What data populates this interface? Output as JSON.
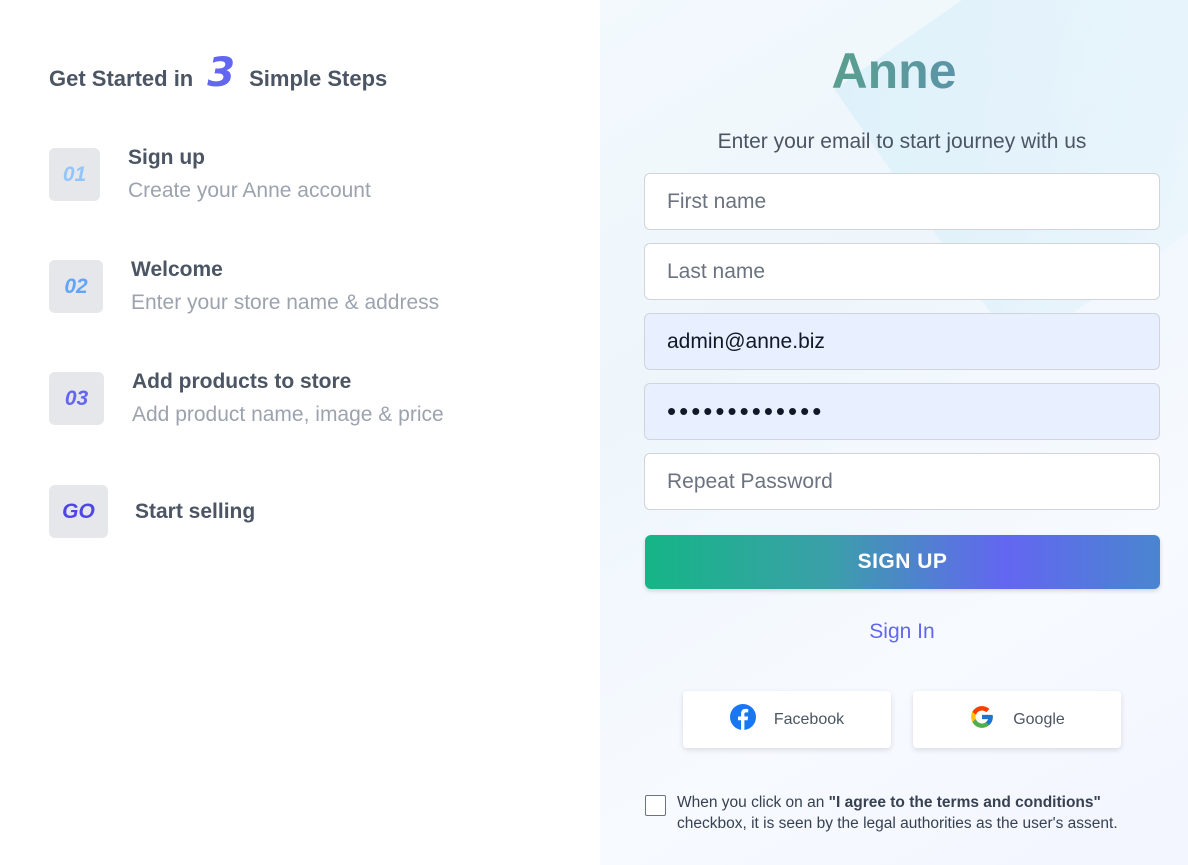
{
  "left": {
    "headline_prefix": "Get Started in",
    "headline_number": "3",
    "headline_suffix": "Simple Steps",
    "steps": [
      {
        "badge": "01",
        "title": "Sign up",
        "subtitle": "Create your Anne account"
      },
      {
        "badge": "02",
        "title": "Welcome",
        "subtitle": "Enter your store name & address"
      },
      {
        "badge": "03",
        "title": "Add products to store",
        "subtitle": "Add product name, image & price"
      },
      {
        "badge": "GO",
        "title": "Start selling"
      }
    ]
  },
  "form": {
    "brand": "Anne",
    "tagline": "Enter your email to start journey with us",
    "first_name": {
      "placeholder": "First name",
      "value": ""
    },
    "last_name": {
      "placeholder": "Last name",
      "value": ""
    },
    "email": {
      "value": "admin@anne.biz"
    },
    "password": {
      "display": "•••••••••••••"
    },
    "repeat_password": {
      "placeholder": "Repeat Password",
      "value": ""
    },
    "signup_button": "SIGN UP",
    "signin_link": "Sign In",
    "social": {
      "facebook": "Facebook",
      "google": "Google"
    },
    "consent": {
      "before": "When you click on an ",
      "bold": "\"I agree to the terms and conditions\"",
      "after": " checkbox, it is seen by the legal authorities as the user's assent.",
      "checked": false
    }
  },
  "colors": {
    "accent": "#6366f1",
    "brand_gradient_start": "#3faa6e",
    "brand_gradient_end": "#5f7fd8",
    "button_gradient_start": "#15b586",
    "button_gradient_end": "#4a85cf",
    "facebook": "#1877f2"
  },
  "icons": {
    "facebook": "facebook-icon",
    "google": "google-icon"
  }
}
